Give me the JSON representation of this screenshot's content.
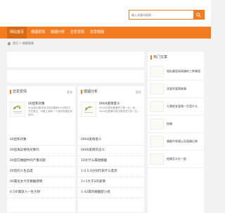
{
  "search": {
    "placeholder": "输入关键词搜索..."
  },
  "nav": {
    "items": [
      "网站首页",
      "婚姻爱情",
      "婚姻分析",
      "恋爱爱情",
      "恋爱婚姻"
    ]
  },
  "breadcrumb": {
    "text": "首页 > 婚姻爱情"
  },
  "col1": {
    "title": "恋爱爱情",
    "more": "更多",
    "featured": {
      "title": "00后和对象",
      "desc": "00后和对象关系中的问题有什么样的方式去表达，对象之间有一个良好的相处状态吗..."
    },
    "list": [
      "00后和对象",
      "00后离异要找对象吗",
      "00后在婚姻中的严重问题",
      "00后的人生态度",
      "00属龙女今年婚姻感情",
      "0.5岁属鼠人一生大财"
    ]
  },
  "col2": {
    "title": "婚姻分析",
    "more": "更多",
    "featured": {
      "title": "0904爱情意义",
      "desc": "0904代表的爱情意义是一生一世，0904在爱情中表示很有意义的一生..."
    },
    "list": [
      "0904爱情意义",
      "0948爱情的含义",
      "10岁什么属相婚姻",
      "1.0.5.0分别代表什么意思",
      "1+1大于2的爱情",
      "1-42属鸡婚姻配小组"
    ]
  },
  "hot": {
    "title": "热门文章",
    "items": [
      "相处最容易离婚的三种属相",
      "深爱的爱情故事",
      "九属蛇女爱情一生是什么",
      "结婚",
      "婚姻中背叛以及离婚后果",
      "结婚怎么在一起"
    ]
  }
}
